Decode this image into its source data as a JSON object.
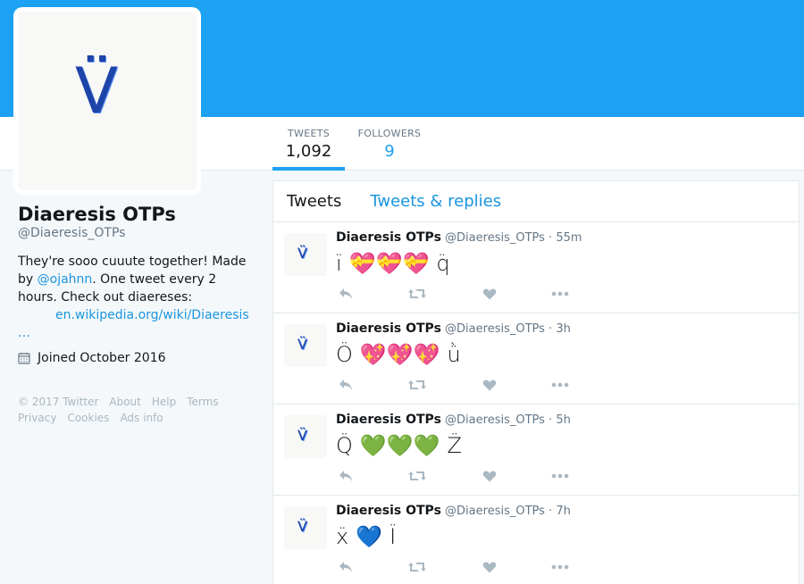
{
  "profile": {
    "name": "Diaeresis OTPs",
    "handle": "@Diaeresis_OTPs",
    "avatar_glyph": "V̈",
    "bio_pre": "They're sooo cuuute together! Made by ",
    "bio_mention": "@ojahnn",
    "bio_post": ". One tweet every 2 hours. Check out diaereses:",
    "bio_url": "en.wikipedia.org/wiki/Diaeresis",
    "bio_ellipsis": "…",
    "joined": "Joined October 2016"
  },
  "stats": {
    "tweets_label": "TWEETS",
    "tweets_value": "1,092",
    "followers_label": "FOLLOWERS",
    "followers_value": "9"
  },
  "footer": {
    "copyright": "© 2017 Twitter",
    "about": "About",
    "help": "Help",
    "terms": "Terms",
    "privacy": "Privacy",
    "cookies": "Cookies",
    "ads_info": "Ads info"
  },
  "timeline": {
    "tab_tweets": "Tweets",
    "tab_replies": "Tweets & replies",
    "tweets": [
      {
        "name": "Diaeresis OTPs",
        "handle": "@Diaeresis_OTPs",
        "time": "55m",
        "left": "ï",
        "emoji": "💝💝💝",
        "right": "q̈"
      },
      {
        "name": "Diaeresis OTPs",
        "handle": "@Diaeresis_OTPs",
        "time": "3h",
        "left": "Ö",
        "emoji": "💖💖💖",
        "right": "ǜ"
      },
      {
        "name": "Diaeresis OTPs",
        "handle": "@Diaeresis_OTPs",
        "time": "5h",
        "left": "Q̈",
        "emoji": "💚💚💚",
        "right": "Z̈"
      },
      {
        "name": "Diaeresis OTPs",
        "handle": "@Diaeresis_OTPs",
        "time": "7h",
        "left": "ẍ",
        "emoji": "💙",
        "right": "Ï"
      }
    ]
  },
  "colors": {
    "brand": "#1da1f2",
    "link": "#1b95e0",
    "muted": "#657786",
    "action_icon": "#aab8c2"
  },
  "icons": {
    "calendar": "calendar-icon",
    "reply": "reply-icon",
    "retweet": "retweet-icon",
    "like": "heart-icon",
    "more": "more-icon"
  }
}
